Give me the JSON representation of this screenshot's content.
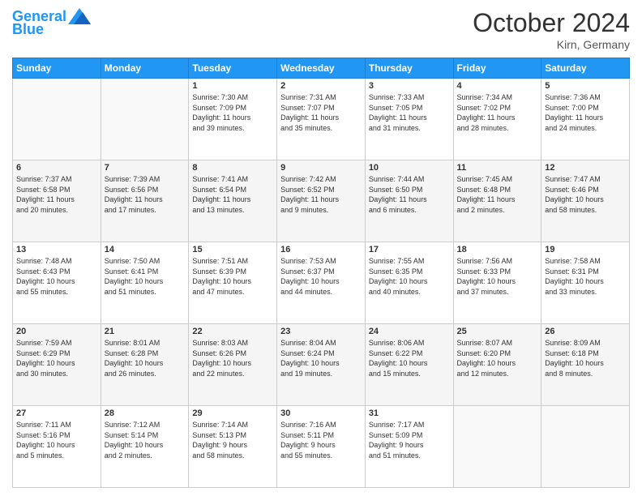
{
  "header": {
    "logo_line1": "General",
    "logo_line2": "Blue",
    "month_year": "October 2024",
    "location": "Kirn, Germany"
  },
  "weekdays": [
    "Sunday",
    "Monday",
    "Tuesday",
    "Wednesday",
    "Thursday",
    "Friday",
    "Saturday"
  ],
  "weeks": [
    [
      {
        "day": "",
        "info": ""
      },
      {
        "day": "",
        "info": ""
      },
      {
        "day": "1",
        "info": "Sunrise: 7:30 AM\nSunset: 7:09 PM\nDaylight: 11 hours\nand 39 minutes."
      },
      {
        "day": "2",
        "info": "Sunrise: 7:31 AM\nSunset: 7:07 PM\nDaylight: 11 hours\nand 35 minutes."
      },
      {
        "day": "3",
        "info": "Sunrise: 7:33 AM\nSunset: 7:05 PM\nDaylight: 11 hours\nand 31 minutes."
      },
      {
        "day": "4",
        "info": "Sunrise: 7:34 AM\nSunset: 7:02 PM\nDaylight: 11 hours\nand 28 minutes."
      },
      {
        "day": "5",
        "info": "Sunrise: 7:36 AM\nSunset: 7:00 PM\nDaylight: 11 hours\nand 24 minutes."
      }
    ],
    [
      {
        "day": "6",
        "info": "Sunrise: 7:37 AM\nSunset: 6:58 PM\nDaylight: 11 hours\nand 20 minutes."
      },
      {
        "day": "7",
        "info": "Sunrise: 7:39 AM\nSunset: 6:56 PM\nDaylight: 11 hours\nand 17 minutes."
      },
      {
        "day": "8",
        "info": "Sunrise: 7:41 AM\nSunset: 6:54 PM\nDaylight: 11 hours\nand 13 minutes."
      },
      {
        "day": "9",
        "info": "Sunrise: 7:42 AM\nSunset: 6:52 PM\nDaylight: 11 hours\nand 9 minutes."
      },
      {
        "day": "10",
        "info": "Sunrise: 7:44 AM\nSunset: 6:50 PM\nDaylight: 11 hours\nand 6 minutes."
      },
      {
        "day": "11",
        "info": "Sunrise: 7:45 AM\nSunset: 6:48 PM\nDaylight: 11 hours\nand 2 minutes."
      },
      {
        "day": "12",
        "info": "Sunrise: 7:47 AM\nSunset: 6:46 PM\nDaylight: 10 hours\nand 58 minutes."
      }
    ],
    [
      {
        "day": "13",
        "info": "Sunrise: 7:48 AM\nSunset: 6:43 PM\nDaylight: 10 hours\nand 55 minutes."
      },
      {
        "day": "14",
        "info": "Sunrise: 7:50 AM\nSunset: 6:41 PM\nDaylight: 10 hours\nand 51 minutes."
      },
      {
        "day": "15",
        "info": "Sunrise: 7:51 AM\nSunset: 6:39 PM\nDaylight: 10 hours\nand 47 minutes."
      },
      {
        "day": "16",
        "info": "Sunrise: 7:53 AM\nSunset: 6:37 PM\nDaylight: 10 hours\nand 44 minutes."
      },
      {
        "day": "17",
        "info": "Sunrise: 7:55 AM\nSunset: 6:35 PM\nDaylight: 10 hours\nand 40 minutes."
      },
      {
        "day": "18",
        "info": "Sunrise: 7:56 AM\nSunset: 6:33 PM\nDaylight: 10 hours\nand 37 minutes."
      },
      {
        "day": "19",
        "info": "Sunrise: 7:58 AM\nSunset: 6:31 PM\nDaylight: 10 hours\nand 33 minutes."
      }
    ],
    [
      {
        "day": "20",
        "info": "Sunrise: 7:59 AM\nSunset: 6:29 PM\nDaylight: 10 hours\nand 30 minutes."
      },
      {
        "day": "21",
        "info": "Sunrise: 8:01 AM\nSunset: 6:28 PM\nDaylight: 10 hours\nand 26 minutes."
      },
      {
        "day": "22",
        "info": "Sunrise: 8:03 AM\nSunset: 6:26 PM\nDaylight: 10 hours\nand 22 minutes."
      },
      {
        "day": "23",
        "info": "Sunrise: 8:04 AM\nSunset: 6:24 PM\nDaylight: 10 hours\nand 19 minutes."
      },
      {
        "day": "24",
        "info": "Sunrise: 8:06 AM\nSunset: 6:22 PM\nDaylight: 10 hours\nand 15 minutes."
      },
      {
        "day": "25",
        "info": "Sunrise: 8:07 AM\nSunset: 6:20 PM\nDaylight: 10 hours\nand 12 minutes."
      },
      {
        "day": "26",
        "info": "Sunrise: 8:09 AM\nSunset: 6:18 PM\nDaylight: 10 hours\nand 8 minutes."
      }
    ],
    [
      {
        "day": "27",
        "info": "Sunrise: 7:11 AM\nSunset: 5:16 PM\nDaylight: 10 hours\nand 5 minutes."
      },
      {
        "day": "28",
        "info": "Sunrise: 7:12 AM\nSunset: 5:14 PM\nDaylight: 10 hours\nand 2 minutes."
      },
      {
        "day": "29",
        "info": "Sunrise: 7:14 AM\nSunset: 5:13 PM\nDaylight: 9 hours\nand 58 minutes."
      },
      {
        "day": "30",
        "info": "Sunrise: 7:16 AM\nSunset: 5:11 PM\nDaylight: 9 hours\nand 55 minutes."
      },
      {
        "day": "31",
        "info": "Sunrise: 7:17 AM\nSunset: 5:09 PM\nDaylight: 9 hours\nand 51 minutes."
      },
      {
        "day": "",
        "info": ""
      },
      {
        "day": "",
        "info": ""
      }
    ]
  ]
}
